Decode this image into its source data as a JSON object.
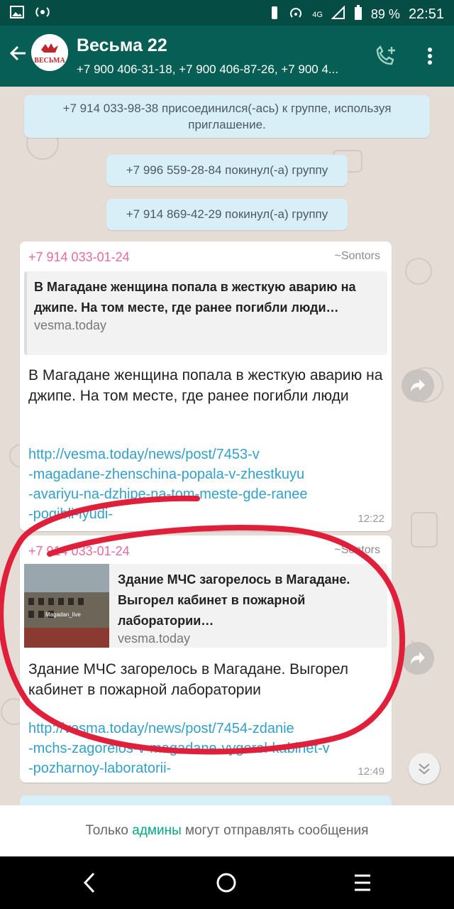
{
  "status_bar": {
    "battery": "89 %",
    "time": "22:51",
    "network": "4G"
  },
  "header": {
    "title": "Весьма 22",
    "subtitle": "+7 900 406-31-18, +7 900 406-87-26, +7 900 4...",
    "avatar_text": "ВЕСЬМА"
  },
  "system_messages": [
    "+7 914 033-98-38 присоединился(-ась) к группе, используя приглашение.",
    "+7 996 559-28-84 покинул(-а) группу",
    "+7 914 869-42-29 покинул(-а) группу"
  ],
  "messages": [
    {
      "sender": "+7 914 033-01-24",
      "alias": "~Sontors",
      "preview_title": "В Магадане женщина попала в жесткую аварию на джипе. На том месте, где ранее погибли люди…",
      "preview_domain": "vesma.today",
      "text": "В Магадане женщина попала в жесткую аварию на джипе. На том месте, где ранее погибли люди",
      "link": "http://vesma.today/news/post/7453-v-magadane-zhenschina-popala-v-zhestkuyu-avariyu-na-dzhipe-na-tom-meste-gde-ranee-pogibli-lyudi-",
      "link_lines": [
        "http://vesma.today/news/post/7453-v",
        "-magadane-zhenschina-popala-v-zhestkuyu",
        "-avariyu-na-dzhipe-na-tom-meste-gde-ranee",
        "-pogibli-lyudi-"
      ],
      "time": "12:22"
    },
    {
      "sender": "+7 914 033-01-24",
      "alias": "~Sontors",
      "preview_title": "Здание МЧС загорелось в Магадане. Выгорел кабинет в пожарной лаборатории…",
      "preview_domain": "vesma.today",
      "thumb_caption": "Magadan_live",
      "text": "Здание МЧС загорелось в Магадане. Выгорел кабинет в пожарной лаборатории",
      "link_lines": [
        "http://vesma.today/news/post/7454-zdanie",
        "-mchs-zagorelos-v-magadane-vygorel-kabinet-v",
        "-pozharnoy-laboratorii-"
      ],
      "time": "12:49"
    }
  ],
  "footer": {
    "admin_prefix": "Только",
    "admin_word": "админы",
    "admin_suffix": "могут отправлять сообщения"
  },
  "colors": {
    "appbar": "#075e54",
    "statusbar": "#054d44",
    "sender": "#e86b9d",
    "link": "#34a0c9",
    "annotation": "#e0203a"
  }
}
